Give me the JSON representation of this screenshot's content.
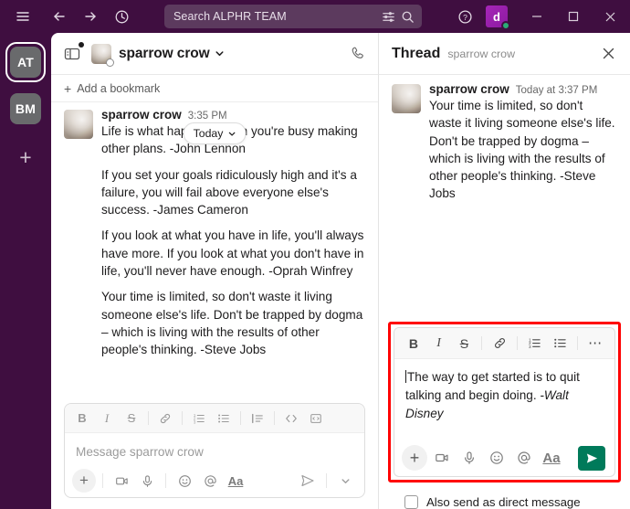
{
  "titlebar": {
    "menu_icon": "hamburger-icon",
    "back_icon": "back-arrow-icon",
    "forward_icon": "forward-arrow-icon",
    "history_icon": "clock-history-icon",
    "search_placeholder": "Search ALPHR TEAM",
    "filter_icon": "search-filter-icon",
    "search_icon": "search-icon",
    "help_icon": "help-circle-icon",
    "avatar_initial": "d",
    "minimize_label": "–",
    "maximize_label": "□",
    "close_label": "✕",
    "bg_color": "#3F0E40",
    "presence_color": "#2BAC76"
  },
  "rail": {
    "workspaces": [
      {
        "initials": "AT",
        "selected": true
      },
      {
        "initials": "BM",
        "selected": false
      }
    ],
    "add_label": "+"
  },
  "channel": {
    "toggle_icon": "panel-toggle-icon",
    "name": "sparrow crow",
    "caret_icon": "chevron-down-icon",
    "call_icon": "phone-call-icon",
    "bookmark_plus": "+",
    "bookmark_label": "Add a bookmark",
    "date_pill": "Today",
    "date_pill_caret": "chevron-down-icon",
    "message": {
      "author": "sparrow crow",
      "time": "3:35 PM",
      "paragraphs": [
        "Life is what happens when you're busy making other plans. -John Lennon",
        "If you set your goals ridiculously high and it's a failure, you will fail above everyone else's success. -James Cameron",
        "If you look at what you have in life, you'll always have more. If you look at what you don't have in life, you'll never have enough. -Oprah Winfrey",
        "Your time is limited, so don't waste it living someone else's life. Don't be trapped by dogma – which is living with the results of other people's thinking. -Steve Jobs"
      ]
    },
    "composer": {
      "placeholder": "Message sparrow crow",
      "format_buttons": [
        "bold-icon",
        "italic-icon",
        "strikethrough-icon",
        "link-icon",
        "ordered-list-icon",
        "bulleted-list-icon",
        "blockquote-icon",
        "code-icon",
        "code-block-icon"
      ],
      "action_buttons": [
        "add-attachment-icon",
        "video-clip-icon",
        "audio-clip-icon",
        "emoji-icon",
        "mention-icon",
        "formatting-icon"
      ],
      "aa_label": "Aa",
      "send_icon": "send-icon",
      "send_options_icon": "chevron-down-icon"
    }
  },
  "thread": {
    "title": "Thread",
    "subtitle": "sparrow crow",
    "close_icon": "close-icon",
    "message": {
      "author": "sparrow crow",
      "time": "Today at 3:37 PM",
      "text": "Your time is limited, so don't waste it living someone else's life. Don't be trapped by dogma – which is living with the results of other people's thinking. -Steve Jobs"
    },
    "composer": {
      "highlight_color": "#FF0000",
      "format_buttons": [
        "bold-icon",
        "italic-icon",
        "strikethrough-icon",
        "link-icon",
        "ordered-list-icon",
        "bulleted-list-icon",
        "more-options-icon"
      ],
      "value_plain": "The way to get started is to quit talking and begin doing. ",
      "value_italic": "-Walt Disney",
      "action_buttons": [
        "add-attachment-icon",
        "video-clip-icon",
        "audio-clip-icon",
        "emoji-icon",
        "mention-icon",
        "formatting-icon"
      ],
      "aa_label": "Aa",
      "send_icon": "send-icon",
      "send_color": "#007A5A"
    },
    "checkbox_label": "Also send as direct message",
    "checkbox_checked": false
  }
}
